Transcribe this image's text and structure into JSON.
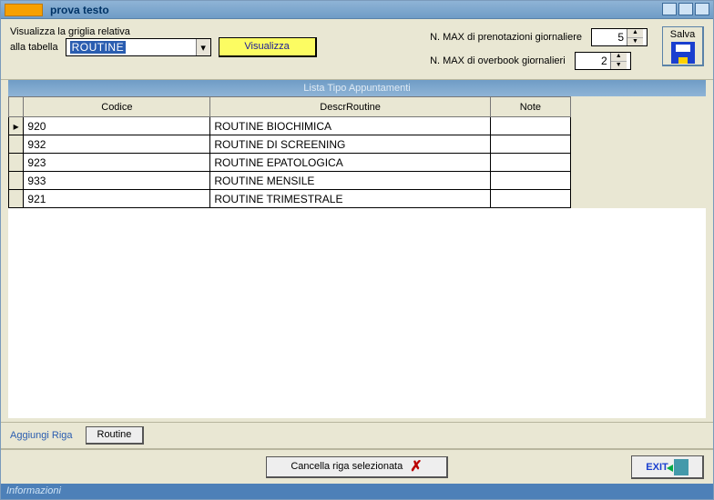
{
  "window": {
    "title": "prova testo"
  },
  "top": {
    "grid_label_line1": "Visualizza la griglia relativa",
    "grid_label_line2": "alla tabella",
    "table_select_value": "ROUTINE",
    "visualizza_label": "Visualizza",
    "max_prenotazioni_label": "N. MAX di prenotazioni giornaliere",
    "max_prenotazioni_value": "5",
    "max_overbook_label": "N. MAX di overbook giornalieri",
    "max_overbook_value": "2",
    "salva_label": "Salva"
  },
  "section_header": "Lista Tipo Appuntamenti",
  "grid": {
    "columns": {
      "codice": "Codice",
      "descr": "DescrRoutine",
      "note": "Note"
    },
    "rows": [
      {
        "codice": "920",
        "descr": "ROUTINE BIOCHIMICA",
        "note": ""
      },
      {
        "codice": "932",
        "descr": "ROUTINE DI SCREENING",
        "note": ""
      },
      {
        "codice": "923",
        "descr": "ROUTINE EPATOLOGICA",
        "note": ""
      },
      {
        "codice": "933",
        "descr": "ROUTINE MENSILE",
        "note": ""
      },
      {
        "codice": "921",
        "descr": "ROUTINE TRIMESTRALE",
        "note": ""
      }
    ]
  },
  "midbar": {
    "aggiungi_label": "Aggiungi Riga",
    "routine_button_label": "Routine"
  },
  "bottom": {
    "cancella_label": "Cancella riga selezionata",
    "exit_label": "EXIT"
  },
  "statusbar": "Informazioni"
}
